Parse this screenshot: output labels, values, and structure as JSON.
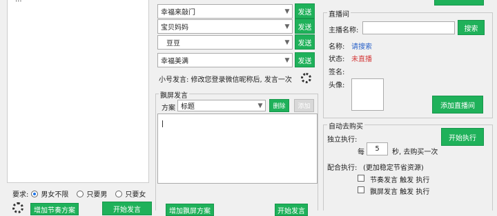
{
  "left_panel": {
    "requirement_label": "要求:",
    "radios": [
      {
        "label": "男女不限",
        "selected": true
      },
      {
        "label": "只要男",
        "selected": false
      },
      {
        "label": "只要女",
        "selected": false
      }
    ],
    "add_rhythm_label": "增加节奏方案",
    "start_send_label": "开始发言"
  },
  "middle_panel": {
    "accounts": [
      {
        "name": "幸福来敲门",
        "send": "发送"
      },
      {
        "name": "宝贝妈妈",
        "send": "发送"
      },
      {
        "name": "豆豆",
        "send": "发送"
      },
      {
        "name": "幸福美满",
        "send": "发送"
      }
    ],
    "alt_speech_text": "小号发言: 修改您登录微信昵称后, 发言一次",
    "screen_speech_title": "飘屏发言",
    "plan_label": "方案",
    "plan_value": "标题",
    "delete_label": "删除",
    "add_label": "添加",
    "add_screen_plan_label": "增加飘屏方案",
    "start_send_label": "开始发言"
  },
  "right_panel": {
    "live_title": "直播间",
    "host_name_label": "主播名称:",
    "search_label": "搜索",
    "nick_label": "名称:",
    "nick_value": "请搜索",
    "status_label": "状态:",
    "status_value": "未直播",
    "sign_label": "签名:",
    "avatar_label": "头像:",
    "add_live_label": "添加直播间",
    "auto_buy_title": "自动去购买",
    "solo_exec_label": "独立执行:",
    "start_exec_label": "开始执行",
    "every_label": "每",
    "seconds_value": "5",
    "per_buy_label": "秒, 去购买一次",
    "combo_exec_label": "配合执行:",
    "combo_exec_note": "(更加稳定节省资源)",
    "options": [
      {
        "label": "节奏发言 触发 执行",
        "checked": false
      },
      {
        "label": "飘屏发言 触发 执行",
        "checked": false
      }
    ]
  },
  "colors": {
    "accent_green": "#1fb15a",
    "link_blue": "#2a62c9",
    "status_red": "#d43a3a"
  }
}
